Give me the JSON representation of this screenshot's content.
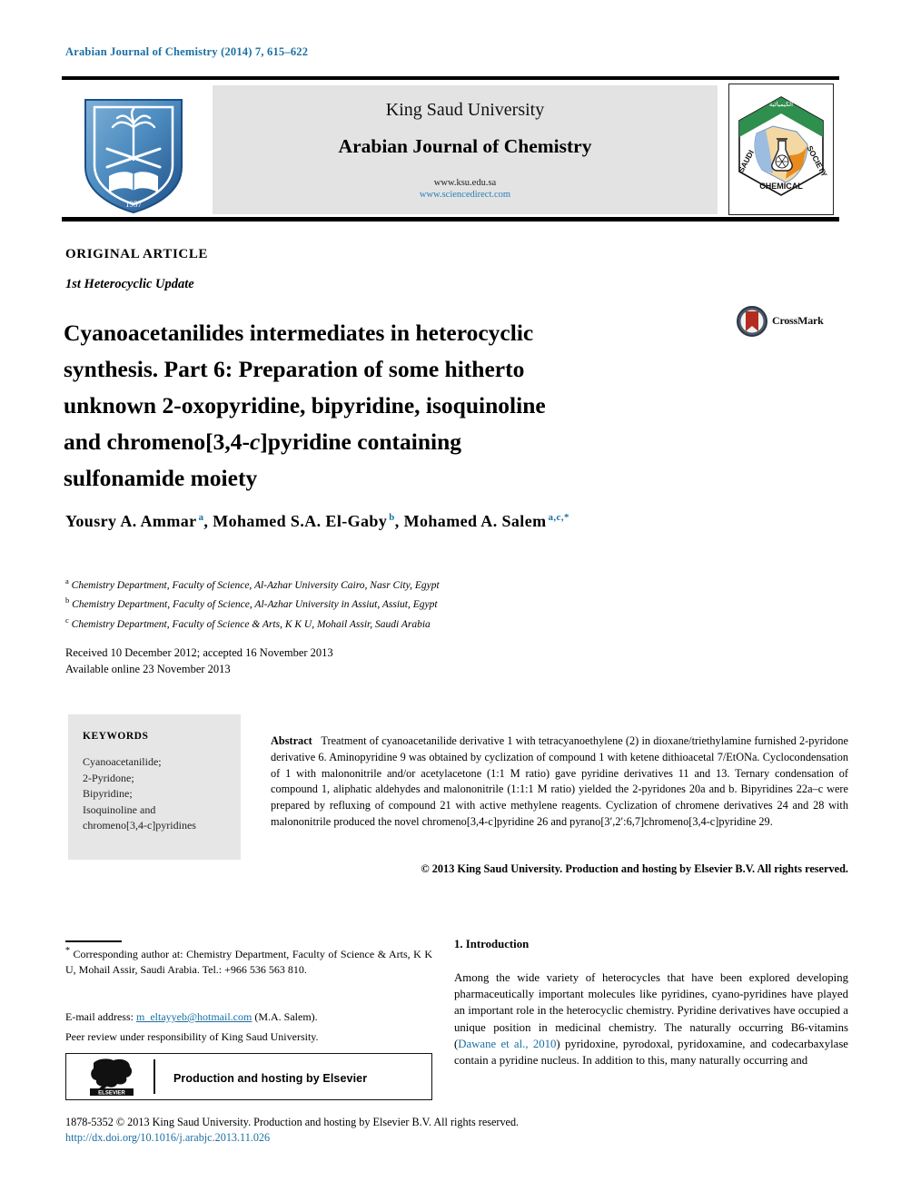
{
  "running_head": "Arabian Journal of Chemistry (2014) 7, 615–622",
  "header": {
    "university": "King Saud University",
    "journal_name": "Arabian Journal of Chemistry",
    "url_ksu": "www.ksu.edu.sa",
    "url_sciencedirect": "www.sciencedirect.com",
    "ksu_logo_alt": "King Saud University 1957",
    "scs_logo_top": "الكيميائية",
    "scs_logo_left": "SAUDI",
    "scs_logo_right": "SOCIETY",
    "scs_logo_bottom": "CHEMICAL"
  },
  "article": {
    "type_label": "ORIGINAL ARTICLE",
    "series_label": "1st Heterocyclic Update",
    "title_line1": "Cyanoacetanilides intermediates in heterocyclic",
    "title_line2": "synthesis. Part 6: Preparation of some hitherto",
    "title_line3": "unknown 2-oxopyridine, bipyridine, isoquinoline",
    "title_line4_a": "and chromeno[3,4-",
    "title_line4_ital": "c",
    "title_line4_b": "]pyridine containing",
    "title_line5": "sulfonamide moiety",
    "crossmark_label": "CrossMark"
  },
  "authors": [
    {
      "name": "Yousry A. Ammar",
      "marks": "a",
      "sep": ", "
    },
    {
      "name": "Mohamed S.A. El-Gaby",
      "marks": "b",
      "sep": ", "
    },
    {
      "name": "Mohamed A. Salem",
      "marks": "a,c,*",
      "sep": ""
    }
  ],
  "affiliations": [
    {
      "mark": "a",
      "text": "Chemistry Department, Faculty of Science, Al-Azhar University Cairo, Nasr City, Egypt"
    },
    {
      "mark": "b",
      "text": "Chemistry Department, Faculty of Science, Al-Azhar University in Assiut, Assiut, Egypt"
    },
    {
      "mark": "c",
      "text": "Chemistry Department, Faculty of Science & Arts, K K U, Mohail Assir, Saudi Arabia"
    }
  ],
  "dates": {
    "received": "Received 10 December 2012; accepted 16 November 2013",
    "available": "Available online 23 November 2013"
  },
  "keywords": {
    "heading": "KEYWORDS",
    "items": [
      "Cyanoacetanilide;",
      "2-Pyridone;",
      "Bipyridine;",
      "Isoquinoline and",
      "chromeno[3,4-c]pyridines"
    ]
  },
  "abstract": {
    "label": "Abstract",
    "body": "Treatment of cyanoacetanilide derivative 1 with tetracyanoethylene (2) in dioxane/triethylamine furnished 2-pyridone derivative 6. Aminopyridine 9 was obtained by cyclization of compound 1 with ketene dithioacetal 7/EtONa. Cyclocondensation of 1 with malononitrile and/or acetylacetone (1:1 M ratio) gave pyridine derivatives 11 and 13. Ternary condensation of compound 1, aliphatic aldehydes and malononitrile (1:1:1 M ratio) yielded the 2-pyridones 20a and b. Bipyridines 22a–c were prepared by refluxing of compound 21 with active methylene reagents. Cyclization of chromene derivatives 24 and 28 with malononitrile produced the novel chromeno[3,4-c]pyridine 26 and pyrano[3′,2′:6,7]chromeno[3,4-c]pyridine 29.",
    "rights": "© 2013 King Saud University. Production and hosting by Elsevier B.V. All rights reserved."
  },
  "footnote": {
    "corresponding": "Corresponding author at: Chemistry Department, Faculty of Science & Arts, K K U, Mohail Assir, Saudi Arabia. Tel.: +966 536 563 810.",
    "email_label": "E-mail address:",
    "email": "m_eltayyeb@hotmail.com",
    "email_suffix": "(M.A. Salem).",
    "peer_review": "Peer review under responsibility of King Saud University.",
    "elsevier_box_text": "Production and hosting by Elsevier",
    "elsevier_logo_label": "ELSEVIER"
  },
  "bottom": {
    "copyright": "1878-5352 © 2013 King Saud University. Production and hosting by Elsevier B.V. All rights reserved.",
    "doi": "http://dx.doi.org/10.1016/j.arabjc.2013.11.026"
  },
  "introduction": {
    "heading": "1. Introduction",
    "text_before_cite": "Among the wide variety of heterocycles that have been explored developing pharmaceutically important molecules like pyridines, cyano-pyridines have played an important role in the heterocyclic chemistry. Pyridine derivatives have occupied a unique position in medicinal chemistry. The naturally occurring B6-vitamins (",
    "citation": "Dawane et al., 2010",
    "text_after_cite": ") pyridoxine, pyrodoxal, pyridoxamine, and codecarbaxylase contain a pyridine nucleus. In addition to this, many naturally occurring and"
  },
  "colors": {
    "link": "#1a6fa3",
    "panel_gray": "#e3e3e3",
    "keyword_gray": "#e6e6e6",
    "ksu_blue": "#2d6ca8",
    "crossmark_red": "#b42b22"
  }
}
